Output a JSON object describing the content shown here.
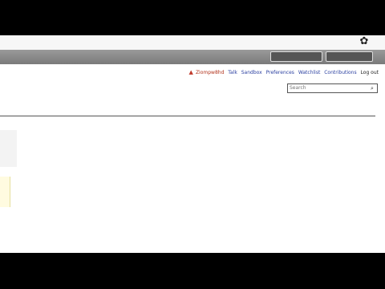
{
  "personal_tools": {
    "username": "Ziompw8hd",
    "links": [
      "Talk",
      "Sandbox",
      "Preferences",
      "Watchlist",
      "Contributions"
    ],
    "logout": "Log out"
  },
  "search": {
    "placeholder": "Search",
    "value": ""
  },
  "icons": {
    "bookmark": "star-icon",
    "user": "user-icon",
    "search": "search-icon"
  }
}
